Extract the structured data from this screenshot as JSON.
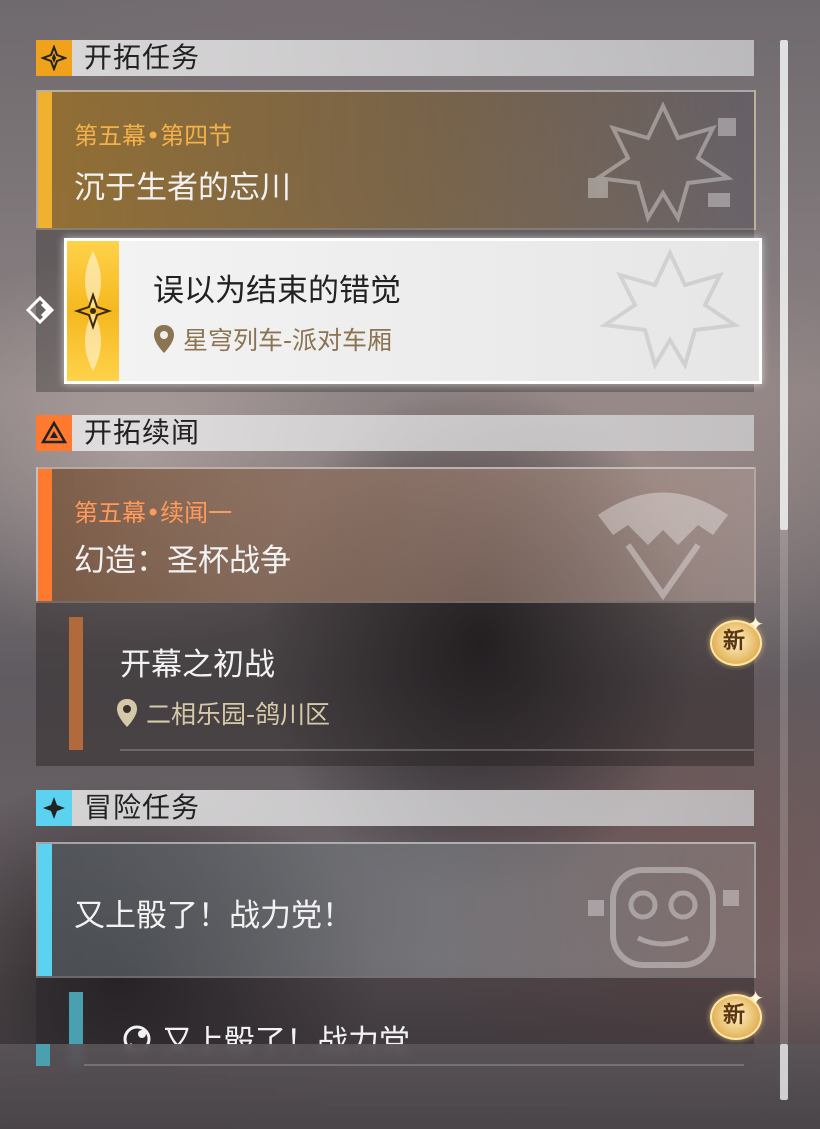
{
  "sections": {
    "trailblaze": {
      "title": "开拓任务",
      "color": "#f0a21b"
    },
    "companion": {
      "title": "开拓续闻",
      "color": "#ff7a2e"
    },
    "adventure": {
      "title": "冒险任务",
      "color": "#5ad2f0"
    }
  },
  "trailblaze_mission": {
    "chapter": "第五幕•第四节",
    "name": "沉于生者的忘川",
    "sub": {
      "name": "误以为结束的错觉",
      "location": "星穹列车-派对车厢"
    }
  },
  "companion_mission": {
    "chapter": "第五幕•续闻一",
    "name": "幻造：圣杯战争",
    "sub": {
      "name": "开幕之初战",
      "location": "二相乐园-鸽川区",
      "badge": "新"
    }
  },
  "adventure_mission": {
    "name": "又上骰了！战力党！",
    "sub": {
      "name": "又上骰了！战力党",
      "badge": "新"
    }
  },
  "icons": {
    "section1": "trailblaze-diamond-icon",
    "section2": "triangle-icon",
    "section3": "four-point-star-icon",
    "location": "location-pin-icon",
    "selector": "double-chevron-icon"
  }
}
